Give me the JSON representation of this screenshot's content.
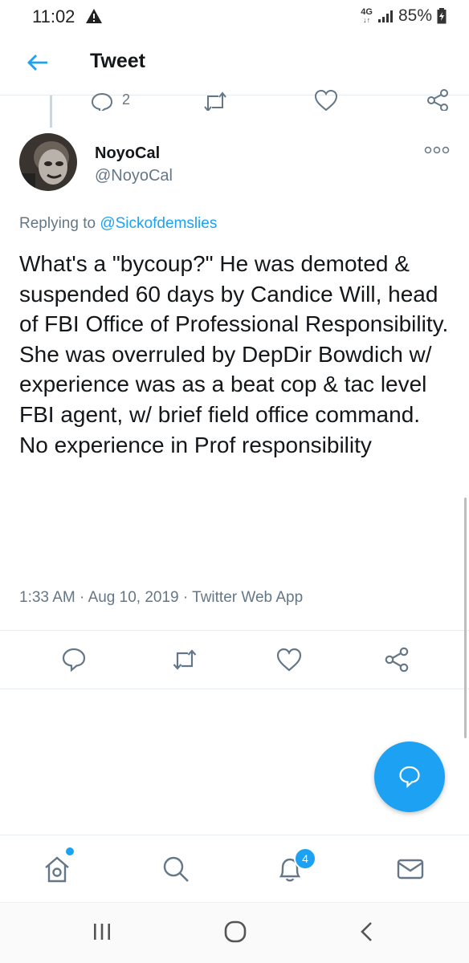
{
  "status_bar": {
    "time": "11:02",
    "network": "4G",
    "battery": "85%"
  },
  "header": {
    "title": "Tweet"
  },
  "previous_tweet": {
    "reply_count": "2"
  },
  "tweet": {
    "author_name": "NoyoCal",
    "author_handle": "@NoyoCal",
    "replying_prefix": "Replying to ",
    "replying_to": "@Sickofdemslies",
    "text": "What's a \"bycoup?\" He was demoted & suspended 60 days by Candice Will, head of FBI Office of Professional Responsibility. She was overruled by DepDir Bowdich w/ experience was as a beat cop & tac level FBI agent, w/ brief field office command. No experience in Prof responsibility",
    "time": "1:33 AM",
    "date": "Aug 10, 2019",
    "source": "Twitter Web App",
    "separator": "·"
  },
  "bottom_nav": {
    "notifications_badge": "4"
  },
  "colors": {
    "accent": "#1da1f2",
    "secondary_text": "#657786",
    "primary_text": "#14171a"
  }
}
